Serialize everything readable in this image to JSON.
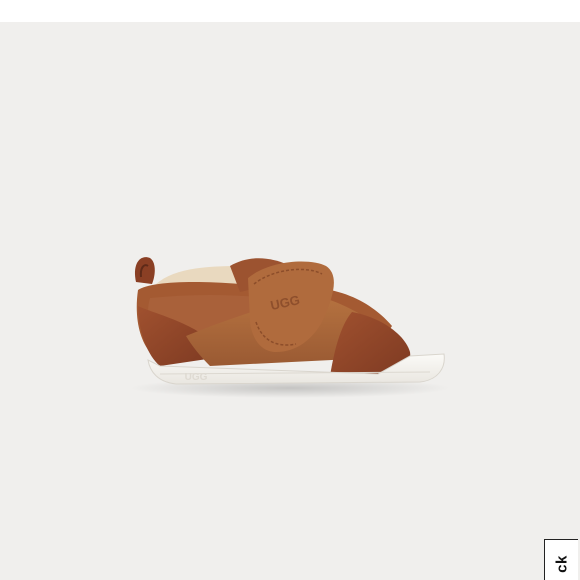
{
  "product": {
    "brand_mark_upper": "UGG",
    "brand_mark_sole": "UGG",
    "image_description_icon": "sneaker-icon"
  },
  "side_tab": {
    "label": "ck"
  },
  "colors": {
    "background": "#f0efed",
    "suede": "#a8643a",
    "leather": "#93452a",
    "sole": "#f4f2ee"
  }
}
